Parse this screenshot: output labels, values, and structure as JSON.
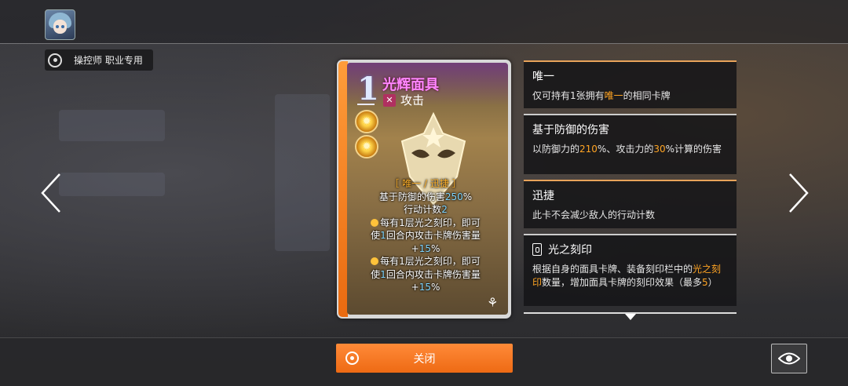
{
  "header": {
    "avatar_icon": "character-avatar-icon",
    "job_tag": "操控师 职业专用"
  },
  "card": {
    "cost": "1",
    "name": "光辉面具",
    "type": "攻击",
    "keywords_line": "［ 唯一 / 迅捷 ］",
    "lines": [
      {
        "text_a": "基于防御的伤害",
        "num": "250",
        "text_b": "%"
      },
      {
        "text_a": "行动计数",
        "num": "2",
        "text_b": ""
      }
    ],
    "effect1": {
      "line1": "每有1层光之刻印，即可",
      "line2_a": "使",
      "line2_num": "1",
      "line2_b": "回合内攻击卡牌伤害量",
      "line3_a": "+",
      "line3_num": "15",
      "line3_b": "%"
    },
    "effect2": {
      "line1": "每有1层光之刻印，即可",
      "line2_a": "使",
      "line2_num": "1",
      "line2_b": "回合内攻击卡牌伤害量",
      "line3_a": "+",
      "line3_num": "15",
      "line3_b": "%"
    }
  },
  "panels": {
    "unique": {
      "title": "唯一",
      "desc_a": "仅可持有1张拥有",
      "desc_hl": "唯一",
      "desc_b": "的相同卡牌"
    },
    "def_damage": {
      "title": "基于防御的伤害",
      "desc_a": "以防御力的",
      "desc_n1": "210",
      "desc_b": "%、攻击力的",
      "desc_n2": "30",
      "desc_c": "%计算的伤害"
    },
    "swift": {
      "title": "迅捷",
      "desc": "此卡不会减少敌人的行动计数"
    },
    "light_mark": {
      "title": "光之刻印",
      "desc_a": "根据自身的面具卡牌、装备刻印栏中的",
      "desc_hl": "光之刻印",
      "desc_b": "数量，增加面具卡牌的刻印效果（最多",
      "desc_n": "5",
      "desc_c": "）"
    }
  },
  "buttons": {
    "close": "关闭"
  },
  "colors": {
    "accent": "#ff7a24",
    "keyword": "#ffa423",
    "number": "#7fd6ff",
    "card_name": "#ff86ff"
  }
}
